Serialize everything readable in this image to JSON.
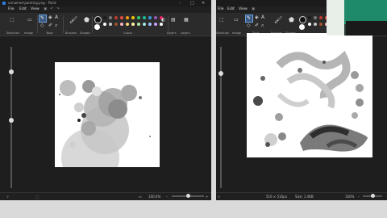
{
  "left_window": {
    "title": "unnamed-painting.png - Paint",
    "menu": [
      "File",
      "Edit",
      "View"
    ],
    "groups": [
      "Selection",
      "Image",
      "Tools",
      "Brushes",
      "Shapes",
      "Colors",
      "Layers",
      "Layers"
    ],
    "status": {
      "zoom": "100.0%"
    }
  },
  "right_window": {
    "menu": [
      "File",
      "Edit",
      "View"
    ],
    "groups": [
      "Selection",
      "Image",
      "Tools",
      "Brushes",
      "Shapes"
    ],
    "status": {
      "dimensions": "516 × 516px",
      "size": "Size: 1.4KB",
      "zoom": "100%"
    }
  },
  "palette": [
    "#1a1a1a",
    "#7a7a7a",
    "#c0392b",
    "#e84c3d",
    "#f39c12",
    "#f1c40f",
    "#2ecc71",
    "#1abc9c",
    "#3498db",
    "#9b59b6",
    "#e91e63",
    "#ffffff",
    "#c8c8c8",
    "#a0522d",
    "#f8b4c0",
    "#ffd27f",
    "#fff3a0",
    "#b5e7a0",
    "#a0e7e5",
    "#a0c4ff",
    "#c8a2ff",
    "#ffffff"
  ],
  "colors": {
    "bg": "#202020",
    "ribbon": "#2b2b2b",
    "accent": "#2f7de1"
  }
}
